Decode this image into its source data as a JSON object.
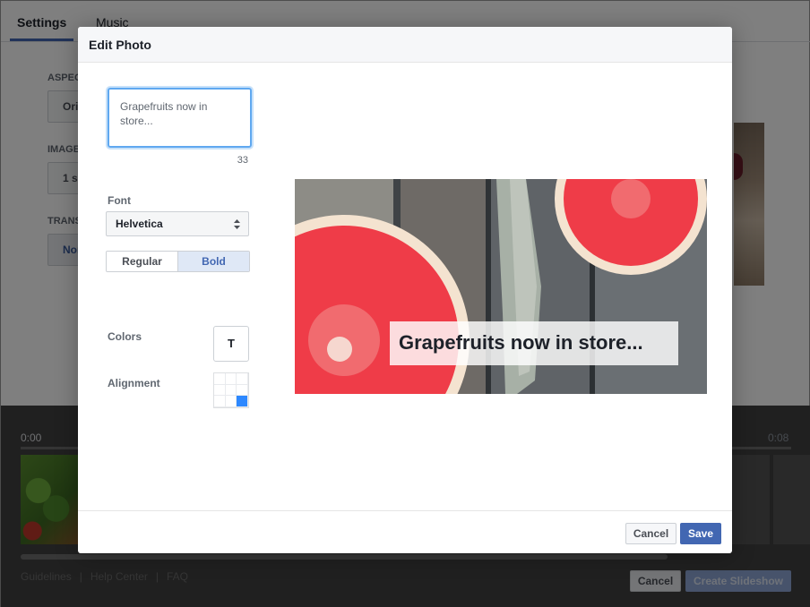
{
  "background": {
    "tabs": [
      {
        "label": "Settings",
        "active": true
      },
      {
        "label": "Music",
        "active": false
      }
    ],
    "settings": {
      "aspect_label": "ASPEC",
      "aspect_value": "Ori",
      "image_label": "IMAGE",
      "image_value": "1 s",
      "trans_label": "TRANS",
      "trans_value": "Nor"
    },
    "timeline": {
      "start_time": "0:00",
      "end_time": "0:08"
    },
    "footer_links": [
      "Guidelines",
      "Help Center",
      "FAQ"
    ],
    "cancel_label": "Cancel",
    "create_label": "Create Slideshow"
  },
  "modal": {
    "title": "Edit Photo",
    "caption": {
      "text": "Grapefruits now in store...",
      "char_count": "33"
    },
    "font": {
      "label": "Font",
      "selected": "Helvetica",
      "weights": [
        "Regular",
        "Bold"
      ],
      "selected_weight": "Bold"
    },
    "colors": {
      "label": "Colors",
      "swatch_text": "T"
    },
    "alignment": {
      "label": "Alignment",
      "selected_cell": "bottom-right"
    },
    "preview": {
      "overlay_text": "Grapefruits now in store..."
    },
    "buttons": {
      "cancel": "Cancel",
      "save": "Save"
    }
  },
  "colors": {
    "accent": "#4267b2",
    "focus": "#5fa8f0",
    "grapefruit": "#ef3c48"
  }
}
